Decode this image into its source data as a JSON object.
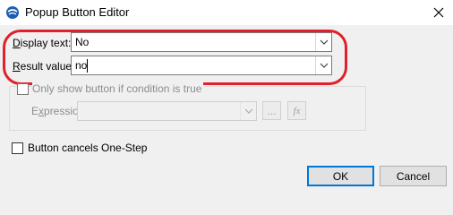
{
  "window": {
    "title": "Popup Button Editor",
    "app_icon": "app-globe-icon",
    "close_glyph": "✕"
  },
  "form": {
    "display_text": {
      "label": "Display text:",
      "accel": "D",
      "value": "No"
    },
    "result_value": {
      "label": "Result value:",
      "accel": "R",
      "value": "no"
    }
  },
  "condition": {
    "checkbox_label": "Only show button if condition is true",
    "expression_label": "Expression:",
    "expression_accel": "x",
    "expression_value": "",
    "ellipsis_label": "...",
    "fx_label": "fx"
  },
  "one_step": {
    "checkbox_label": "Button cancels One-Step"
  },
  "buttons": {
    "ok": "OK",
    "cancel": "Cancel"
  },
  "colors": {
    "highlight": "#e0202a",
    "default_button": "#0078d7"
  }
}
